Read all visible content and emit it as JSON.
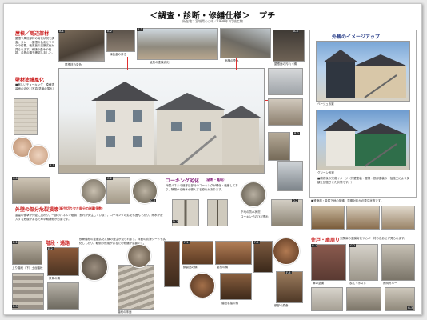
{
  "header": {
    "title": "＜調査・診断・修繕仕様＞　プチ",
    "subtitle": "所在地：宮城県○○市／1998年3月竣工物"
  },
  "roof": {
    "heading": "屋根／周辺部材",
    "note": "屋根や周辺部材の劣化状況を調査。スレート屋根の色あせやコケの付着、破風板の塗膜劣化が見られます。雨樋の歪みや破損、金具の錆も確認しました。",
    "captions": [
      "屋根材の変色",
      "棟板金の浮き",
      "破風の塗膜劣化",
      "雨樋の歪み",
      "屋根面の汚れ・錆"
    ]
  },
  "wall": {
    "heading": "壁材塗膜風化",
    "note": "■著しいチョーキング　模様塗装面の劣化（写真:塗膜の薄れ）"
  },
  "split": {
    "heading": "外壁の部分危裂損壊",
    "heading_sub": "（新生切り欠き部分の剥離多数）",
    "note": "重量の衝撃が外壁に加わり、一部のパネルで破損・割れが発生しています。コーキングの劣化も進んでおり、雨水が浸入する危険があるため早期補修が必要です。"
  },
  "caulk": {
    "heading": "コーキング劣化",
    "heading_sub": "（破断・亀裂）",
    "note": "外壁パネルの継ぎ目部分のコーキングが硬化・破断しており、隙間から雨水が侵入する恐れがあります。",
    "captions": [
      "下地の防水状況",
      "コーキングのひび割れ"
    ]
  },
  "stairs": {
    "heading": "階段・通路",
    "note": "鉄骨階段の塗膜劣化と錆の発生が見られます。床面の防滑シートも劣化しており、転倒の危険があるため修繕が必要です。",
    "captions": [
      "上り階段（下）土台階段",
      "鉄骨の錆",
      "階段の床面"
    ]
  },
  "rust": {
    "note": "■鉄骨部・金属下地の発錆、早期対処が必要な状態です。",
    "captions": [
      "鋼製品の錆",
      "屋根の錆",
      "階段手摺の錆",
      "鉄部の腐食"
    ]
  },
  "housing": {
    "heading": "住戸・扉周り",
    "note": "玄関扉の塗膜劣化やカバー材の色あせが見られます。",
    "captions": [
      "扉の塗膜",
      "表札・ポスト",
      "照明カバー"
    ]
  },
  "image_up": {
    "heading": "外観のイメージアップ",
    "note": "■補修後の完成イメージ（外壁塗装・屋根・鉄部塗装の一括施工により美観を回復させた状態です。）",
    "captions": [
      "ベージュ系案",
      "グリーン系案"
    ]
  },
  "tags": [
    "A-1",
    "A-2",
    "A-3",
    "A-4",
    "B-1",
    "B-2",
    "B-3",
    "C-1",
    "C-2",
    "C-3",
    "D-1",
    "D-2",
    "E-1",
    "E-2",
    "E-3",
    "E-4",
    "F-1",
    "F-2",
    "F-3",
    "G-1",
    "G-2",
    "G-3"
  ],
  "colors": {
    "accent_red": "#cc2222",
    "accent_purple": "#8a2a80",
    "accent_blue": "#2a3f8a"
  }
}
